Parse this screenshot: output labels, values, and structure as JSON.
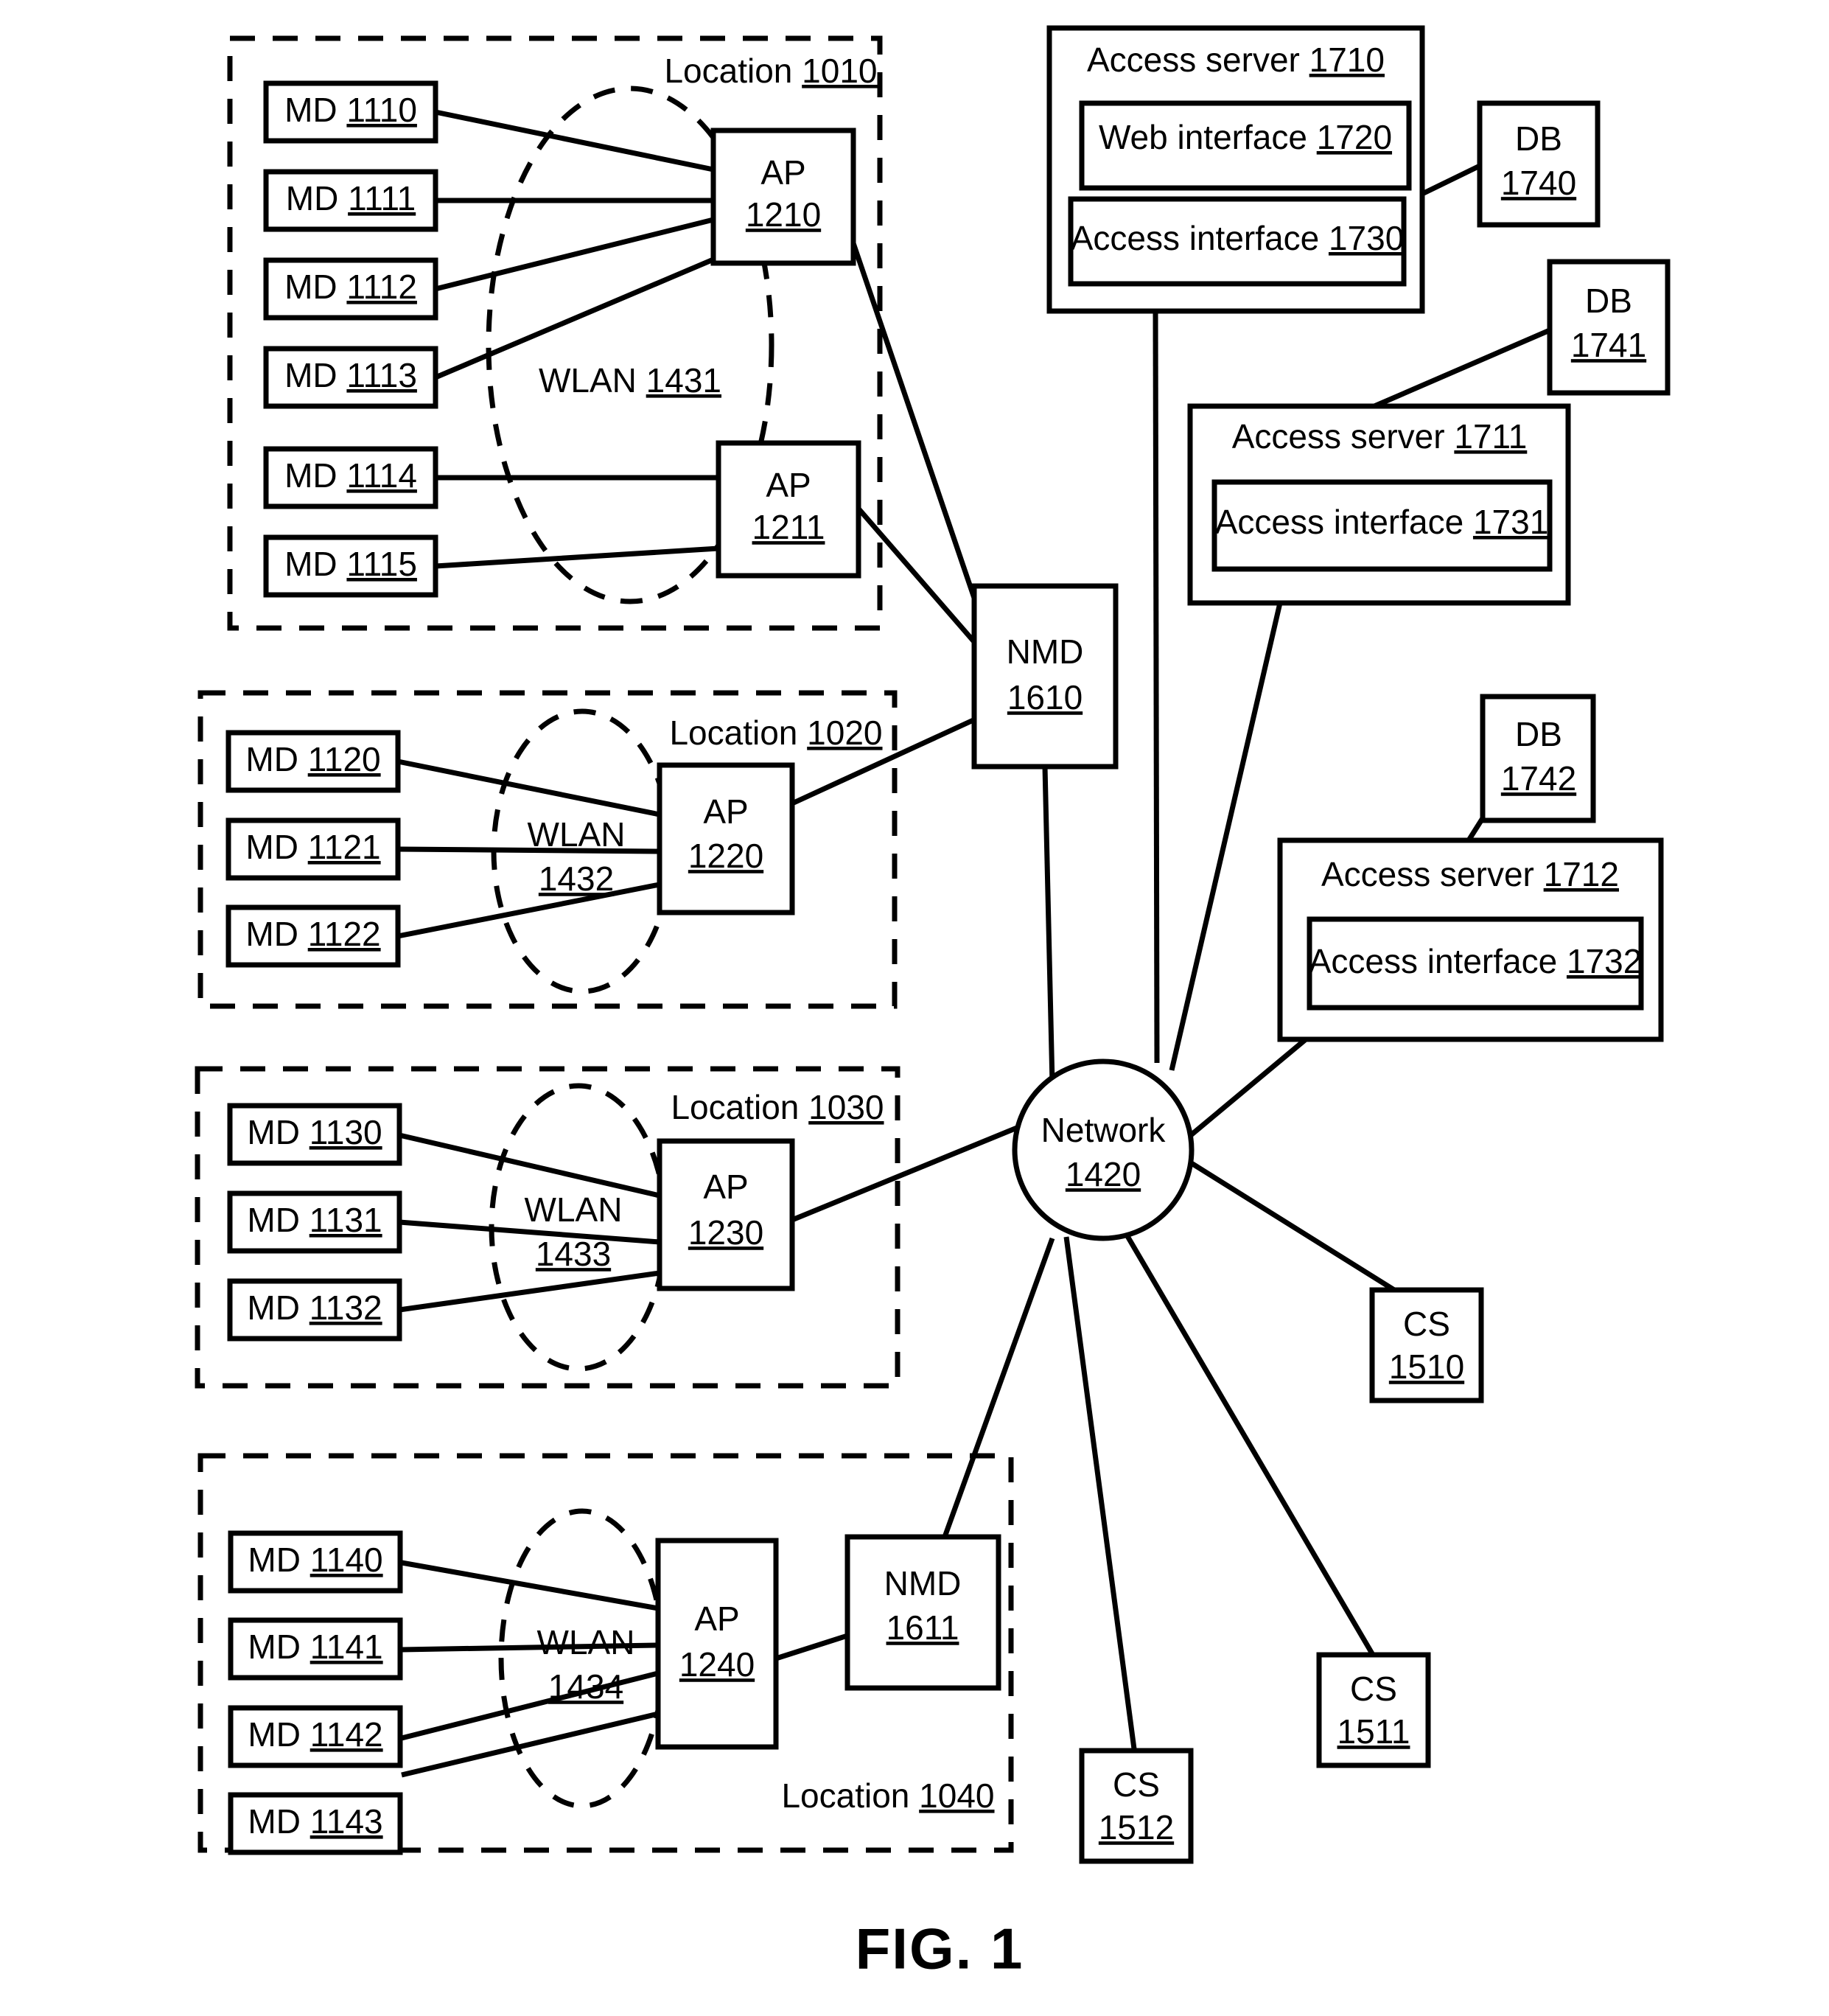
{
  "figure": {
    "caption": "FIG. 1",
    "type": "network architecture diagram"
  },
  "locations": [
    {
      "id": "location-1010",
      "label_prefix": "Location",
      "label_ref": "1010",
      "wlan": {
        "prefix": "WLAN",
        "ref": "1431"
      },
      "devices": [
        {
          "prefix": "MD",
          "ref": "1110"
        },
        {
          "prefix": "MD",
          "ref": "1111"
        },
        {
          "prefix": "MD",
          "ref": "1112"
        },
        {
          "prefix": "MD",
          "ref": "1113"
        },
        {
          "prefix": "MD",
          "ref": "1114"
        },
        {
          "prefix": "MD",
          "ref": "1115"
        }
      ],
      "access_points": [
        {
          "prefix": "AP",
          "ref": "1210"
        },
        {
          "prefix": "AP",
          "ref": "1211"
        }
      ]
    },
    {
      "id": "location-1020",
      "label_prefix": "Location",
      "label_ref": "1020",
      "wlan": {
        "prefix": "WLAN",
        "ref": "1432"
      },
      "devices": [
        {
          "prefix": "MD",
          "ref": "1120"
        },
        {
          "prefix": "MD",
          "ref": "1121"
        },
        {
          "prefix": "MD",
          "ref": "1122"
        }
      ],
      "access_points": [
        {
          "prefix": "AP",
          "ref": "1220"
        }
      ]
    },
    {
      "id": "location-1030",
      "label_prefix": "Location",
      "label_ref": "1030",
      "wlan": {
        "prefix": "WLAN",
        "ref": "1433"
      },
      "devices": [
        {
          "prefix": "MD",
          "ref": "1130"
        },
        {
          "prefix": "MD",
          "ref": "1131"
        },
        {
          "prefix": "MD",
          "ref": "1132"
        }
      ],
      "access_points": [
        {
          "prefix": "AP",
          "ref": "1230"
        }
      ]
    },
    {
      "id": "location-1040",
      "label_prefix": "Location",
      "label_ref": "1040",
      "wlan": {
        "prefix": "WLAN",
        "ref": "1434"
      },
      "devices": [
        {
          "prefix": "MD",
          "ref": "1140"
        },
        {
          "prefix": "MD",
          "ref": "1141"
        },
        {
          "prefix": "MD",
          "ref": "1142"
        },
        {
          "prefix": "MD",
          "ref": "1143"
        }
      ],
      "access_points": [
        {
          "prefix": "AP",
          "ref": "1240"
        }
      ],
      "nmd": {
        "prefix": "NMD",
        "ref": "1611"
      }
    }
  ],
  "nmd_1610": {
    "prefix": "NMD",
    "ref": "1610"
  },
  "nmd_1611": {
    "prefix": "NMD",
    "ref": "1611"
  },
  "network": {
    "prefix": "Network",
    "ref": "1420"
  },
  "access_servers": [
    {
      "id": "access-server-1710",
      "prefix": "Access server",
      "ref": "1710",
      "components": [
        {
          "prefix": "Web interface",
          "ref": "1720"
        },
        {
          "prefix": "Access interface",
          "ref": "1730"
        }
      ]
    },
    {
      "id": "access-server-1711",
      "prefix": "Access server",
      "ref": "1711",
      "components": [
        {
          "prefix": "Access interface",
          "ref": "1731"
        }
      ]
    },
    {
      "id": "access-server-1712",
      "prefix": "Access server",
      "ref": "1712",
      "components": [
        {
          "prefix": "Access interface",
          "ref": "1732"
        }
      ]
    }
  ],
  "databases": [
    {
      "prefix": "DB",
      "ref": "1740"
    },
    {
      "prefix": "DB",
      "ref": "1741"
    },
    {
      "prefix": "DB",
      "ref": "1742"
    }
  ],
  "client_stations": [
    {
      "prefix": "CS",
      "ref": "1510"
    },
    {
      "prefix": "CS",
      "ref": "1511"
    },
    {
      "prefix": "CS",
      "ref": "1512"
    }
  ],
  "colors": {
    "stroke": "#000000",
    "fill": "#ffffff"
  }
}
